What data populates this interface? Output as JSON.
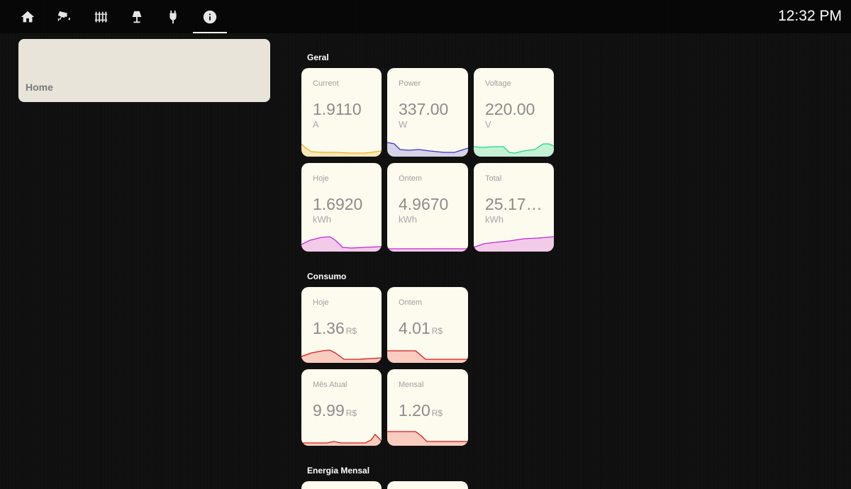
{
  "header": {
    "clock": "12:32 PM",
    "tabs": [
      {
        "icon": "home-icon"
      },
      {
        "icon": "cctv-camera-icon"
      },
      {
        "icon": "radiator-icon"
      },
      {
        "icon": "floor-lamp-icon"
      },
      {
        "icon": "power-plug-icon"
      },
      {
        "icon": "information-icon",
        "active": true
      }
    ]
  },
  "sidebar": {
    "home_label": "Home"
  },
  "sections": {
    "geral": "Geral",
    "consumo": "Consumo",
    "energia_mensal": "Energia Mensal"
  },
  "geral": [
    {
      "name": "Current",
      "value": "1.9110",
      "unit": "A",
      "color": "#e8b21c"
    },
    {
      "name": "Power",
      "value": "337.00",
      "unit": "W",
      "color": "#3535c8"
    },
    {
      "name": "Voltage",
      "value": "220.00",
      "unit": "V",
      "color": "#1fd88a"
    },
    {
      "name": "Hoje",
      "value": "1.6920",
      "unit": "kWh",
      "color": "#c824d8"
    },
    {
      "name": "Ontem",
      "value": "4.9670",
      "unit": "kWh",
      "color": "#c824d8"
    },
    {
      "name": "Total",
      "value": "25.17…",
      "unit": "kWh",
      "color": "#c824d8"
    }
  ],
  "consumo": [
    {
      "name": "Hoje",
      "value": "1.36",
      "unit": "R$",
      "color": "#d81c1c"
    },
    {
      "name": "Ontem",
      "value": "4.01",
      "unit": "R$",
      "color": "#d81c1c"
    },
    {
      "name": "Mês Atual",
      "value": "9.99",
      "unit": "R$",
      "color": "#d81c1c"
    },
    {
      "name": "Mensal",
      "value": "1.20",
      "unit": "R$",
      "color": "#d81c1c"
    }
  ]
}
